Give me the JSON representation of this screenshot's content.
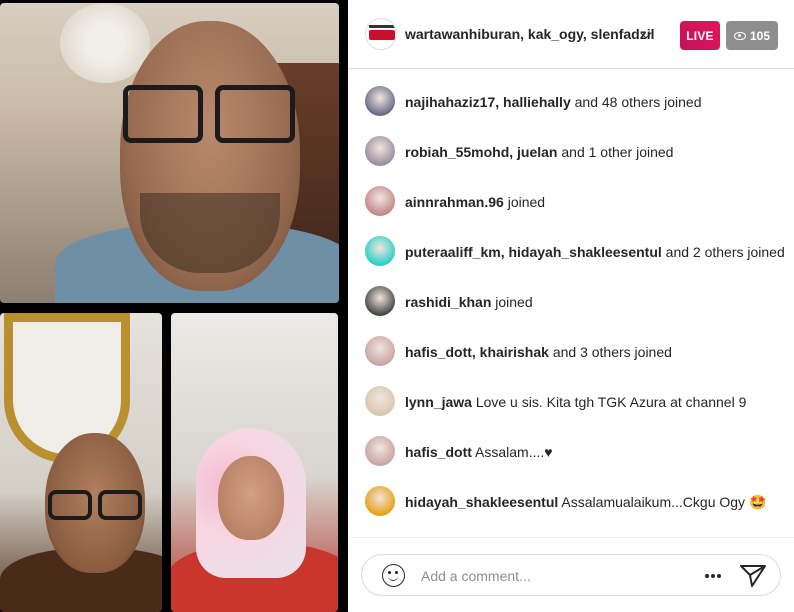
{
  "header": {
    "hosts": "wartawanhiburan, kak_ogy, slenfadzil",
    "live_label": "LIVE",
    "viewer_count": "105"
  },
  "feed": [
    {
      "user": "najihahaziz17, halliehally and 48 others joined",
      "message": "",
      "avatar_color": "#6a6f8a"
    },
    {
      "user": "robiah_55mohd, juelan and 1 other joined",
      "message": "",
      "avatar_color": "#9b8fa2"
    },
    {
      "user": "ainnrahman.96 joined",
      "message": "",
      "avatar_color": "#c48a8e"
    },
    {
      "user": "puteraaliff_km, hidayah_shakleesentul and 2 others joined",
      "message": "",
      "avatar_color": "#2ed0c8"
    },
    {
      "user": "rashidi_khan joined",
      "message": "",
      "avatar_color": "#4a4a4a"
    },
    {
      "user": "hafis_dott, khairishak and 3 others joined",
      "message": "",
      "avatar_color": "#c9a6a4"
    },
    {
      "user": "lynn_jawa",
      "message": "Love u sis. Kita tgh TGK Azura at channel 9",
      "avatar_color": "#d9c7b0"
    },
    {
      "user": "hafis_dott",
      "message": "Assalam....♥",
      "avatar_color": "#c9a6a4"
    },
    {
      "user": "hidayah_shakleesentul",
      "message": "Assalamualaikum...Ckgu Ogy 🤩",
      "avatar_color": "#e6a21c"
    }
  ],
  "comment": {
    "placeholder": "Add a comment..."
  },
  "colors": {
    "live_accent": "#d9135d",
    "viewer_badge": "#8e8e8e"
  }
}
